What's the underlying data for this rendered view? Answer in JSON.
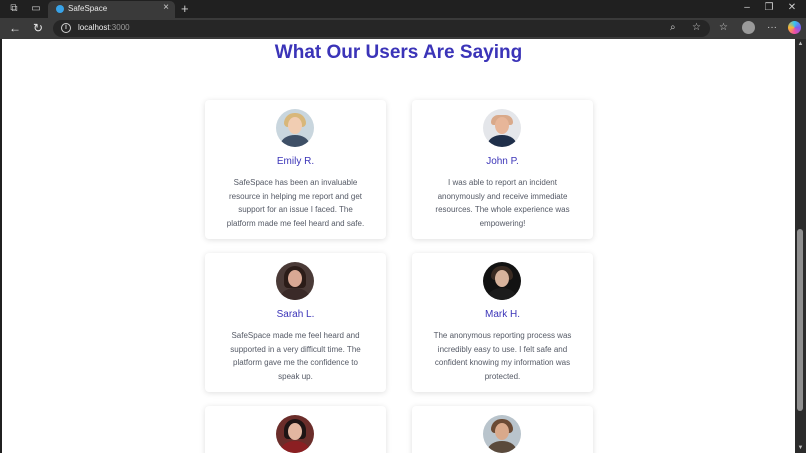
{
  "browser": {
    "tab_title": "SafeSpace",
    "url_host": "localhost",
    "url_port": ":3000"
  },
  "page": {
    "heading": "What Our Users Are Saying",
    "testimonials": [
      {
        "name": "Emily R.",
        "quote": "SafeSpace has been an invaluable resource in helping me report and get support for an issue I faced. The platform made me feel heard and safe."
      },
      {
        "name": "John P.",
        "quote": "I was able to report an incident anonymously and receive immediate resources. The whole experience was empowering!"
      },
      {
        "name": "Sarah L.",
        "quote": "SafeSpace made me feel heard and supported in a very difficult time. The platform gave me the confidence to speak up."
      },
      {
        "name": "Mark H.",
        "quote": "The anonymous reporting process was incredibly easy to use. I felt safe and confident knowing my information was protected."
      },
      {
        "name": "",
        "quote": ""
      },
      {
        "name": "",
        "quote": ""
      }
    ]
  },
  "colors": {
    "accent": "#3b34b8",
    "quote_text": "#555a66",
    "favicon": "#38a3e8"
  }
}
